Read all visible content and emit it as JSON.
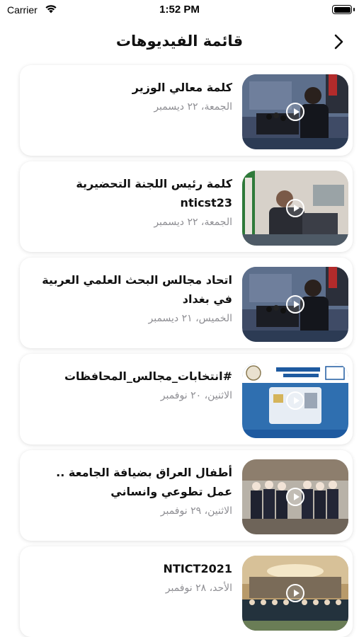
{
  "status_bar": {
    "carrier": "Carrier",
    "time": "1:52 PM",
    "wifi_icon": "wifi-icon",
    "battery_icon": "battery-icon"
  },
  "nav": {
    "title": "قائمة الفيديوهات",
    "back_icon": "chevron-right-icon"
  },
  "videos": [
    {
      "title": "كلمة معالي الوزير",
      "date": "الجمعة، ٢٢ ديسمبر",
      "thumb_scene": "podium-speaker"
    },
    {
      "title": "كلمة رئيس اللجنة التحضيرية nticst23",
      "date": "الجمعة، ٢٢ ديسمبر",
      "thumb_scene": "podium-speaker-flag"
    },
    {
      "title": "اتحاد مجالس البحث العلمي العربية في بغداد",
      "date": "الخميس، ٢١ ديسمبر",
      "thumb_scene": "podium-speaker"
    },
    {
      "title": "#انتخابات_مجالس_المحافظات",
      "date": "الاثنين، ٢٠ نوفمبر",
      "thumb_scene": "id-card"
    },
    {
      "title": "أطفال العراق بضيافة الجامعة .. عمل تطوعي وانساني",
      "date": "الاثنين، ٢٩ نوفمبر",
      "thumb_scene": "children-group"
    },
    {
      "title": "NTICT2021",
      "date": "الأحد، ٢٨ نوفمبر",
      "thumb_scene": "conference-hall"
    }
  ],
  "colors": {
    "background": "#ffffff",
    "card": "#ffffff",
    "date_text": "#8e8e93",
    "title_text": "#111111"
  }
}
